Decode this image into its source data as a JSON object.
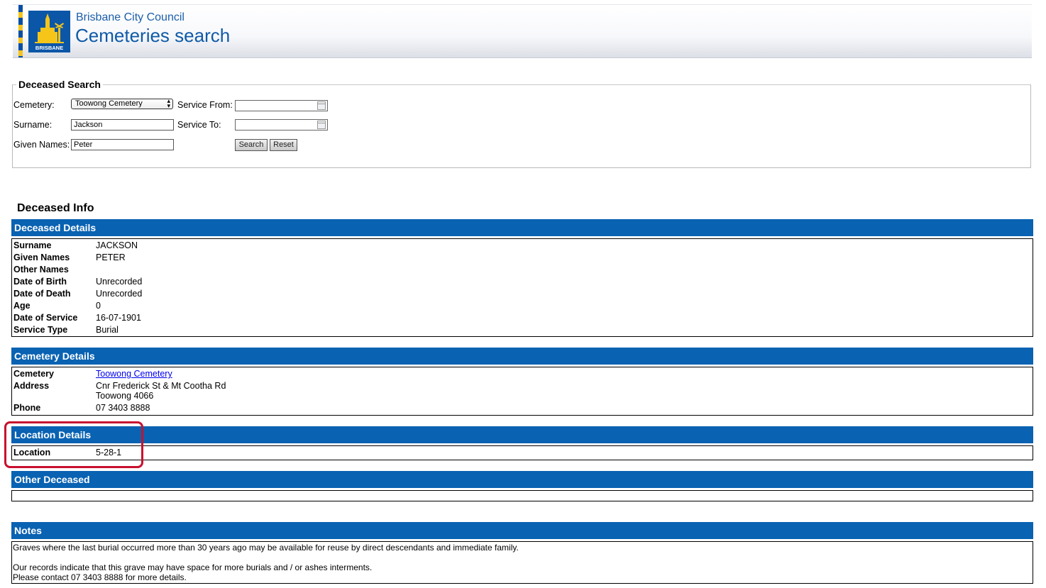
{
  "header": {
    "council_name": "Brisbane City Council",
    "site_title": "Cemeteries search",
    "logo_text": "BRISBANE"
  },
  "search": {
    "legend": "Deceased Search",
    "cemetery_label": "Cemetery:",
    "cemetery_value": "Toowong Cemetery",
    "surname_label": "Surname:",
    "surname_value": "Jackson",
    "given_names_label": "Given Names:",
    "given_names_value": "Peter",
    "service_from_label": "Service From:",
    "service_from_value": "",
    "service_to_label": "Service To:",
    "service_to_value": "",
    "search_button": "Search",
    "reset_button": "Reset"
  },
  "info": {
    "title": "Deceased Info",
    "deceased_header": "Deceased Details",
    "deceased": [
      {
        "label": "Surname",
        "value": "JACKSON"
      },
      {
        "label": "Given Names",
        "value": "PETER"
      },
      {
        "label": "Other Names",
        "value": ""
      },
      {
        "label": "Date of Birth",
        "value": "Unrecorded"
      },
      {
        "label": "Date of Death",
        "value": "Unrecorded"
      },
      {
        "label": "Age",
        "value": "0"
      },
      {
        "label": "Date of Service",
        "value": "16-07-1901"
      },
      {
        "label": "Service Type",
        "value": "Burial"
      }
    ],
    "cemetery_header": "Cemetery Details",
    "cemetery": {
      "cemetery_label": "Cemetery",
      "cemetery_value": "Toowong Cemetery",
      "address_label": "Address",
      "address_line1": "Cnr Frederick St & Mt Cootha Rd",
      "address_line2": "Toowong 4066",
      "phone_label": "Phone",
      "phone_value": "07 3403 8888"
    },
    "location_header": "Location Details",
    "location": {
      "label": "Location",
      "value": "5-28-1"
    },
    "other_header": "Other Deceased",
    "notes_header": "Notes",
    "notes": [
      "Graves where the last burial occurred more than 30 years ago may be available for reuse by direct descendants and immediate family.",
      "Our records indicate that this grave may have space for more burials and / or ashes interments.",
      "Please contact 07 3403 8888 for more details."
    ]
  },
  "colors": {
    "section_bar": "#0962b2",
    "highlight": "#c8102e",
    "brand_blue": "#0f5aa7"
  }
}
